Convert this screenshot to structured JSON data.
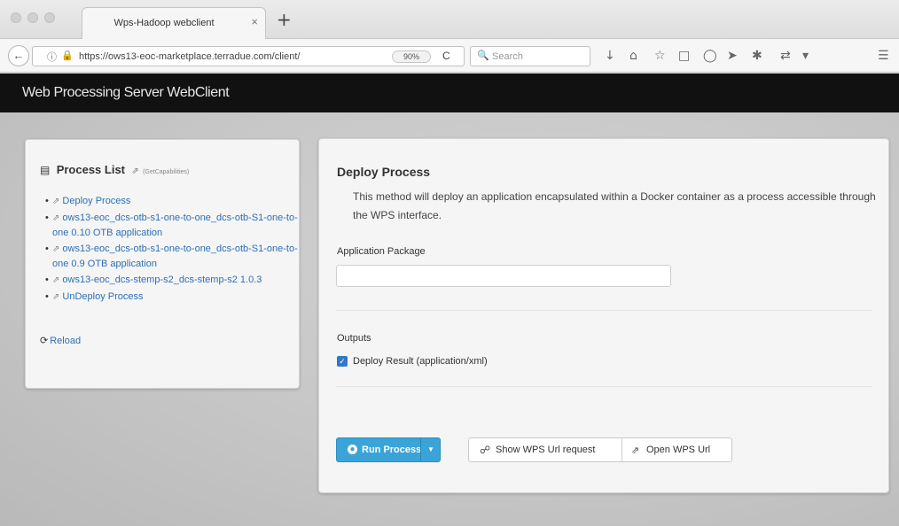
{
  "browser": {
    "tab_title": "Wps-Hadoop webclient",
    "tab_close": "×",
    "new_tab": "+",
    "url": "https://ows13-eoc-marketplace.terradue.com/client/",
    "zoom": "90%",
    "search_placeholder": "Search"
  },
  "app": {
    "title": "Web Processing Server WebClient"
  },
  "process_list": {
    "title": "Process List",
    "getcap_label": "(GetCapabilities)",
    "items": [
      {
        "label": "Deploy Process"
      },
      {
        "label": "ows13-eoc_dcs-otb-s1-one-to-one_dcs-otb-S1-one-to-one 0.10 OTB application"
      },
      {
        "label": "ows13-eoc_dcs-otb-s1-one-to-one_dcs-otb-S1-one-to-one 0.9 OTB application"
      },
      {
        "label": "ows13-eoc_dcs-stemp-s2_dcs-stemp-s2 1.0.3"
      },
      {
        "label": "UnDeploy Process"
      }
    ],
    "reload_label": "Reload"
  },
  "deploy": {
    "title": "Deploy Process",
    "description": "This method will deploy an application encapsulated within a Docker container as a process accessible through the WPS interface.",
    "package_label": "Application Package",
    "package_value": "",
    "outputs_label": "Outputs",
    "output_item": "Deploy Result (application/xml)",
    "output_checked": true
  },
  "actions": {
    "run_label": "Run Process",
    "show_url_label": "Show WPS Url request",
    "open_url_label": "Open WPS Url"
  },
  "colors": {
    "accent": "#3aa4d8",
    "link": "#2b6fb6",
    "appbar": "#111111"
  },
  "icons": {
    "back": "back-arrow-icon",
    "search": "search-icon",
    "reload": "reload-icon",
    "download": "download-icon",
    "home": "home-icon",
    "bookmark": "star-icon",
    "menu": "hamburger-menu-icon"
  }
}
